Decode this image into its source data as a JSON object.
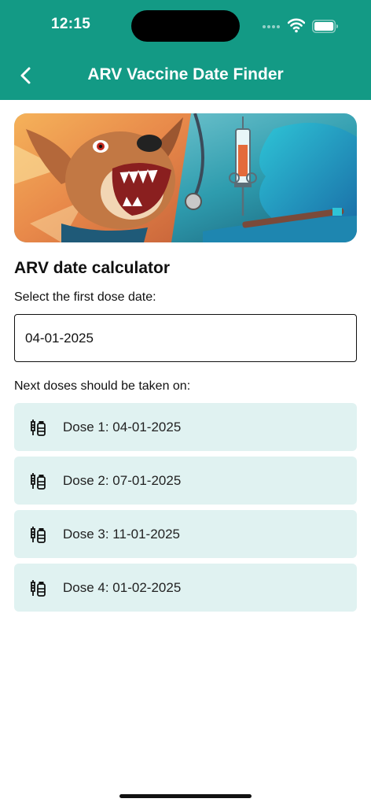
{
  "status_bar": {
    "time": "12:15"
  },
  "app_bar": {
    "title": "ARV Vaccine Date Finder",
    "back_icon": "chevron-left-icon"
  },
  "banner": {
    "description": "dog-and-syringe-illustration"
  },
  "calculator": {
    "heading": "ARV date calculator",
    "select_label": "Select the first dose date:",
    "first_dose_value": "04-01-2025",
    "next_label": "Next doses should be taken on:"
  },
  "doses": [
    {
      "text": "Dose 1: 04-01-2025"
    },
    {
      "text": "Dose 2: 07-01-2025"
    },
    {
      "text": "Dose 3: 11-01-2025"
    },
    {
      "text": "Dose 4: 01-02-2025"
    }
  ],
  "colors": {
    "header": "#139a85",
    "dose_background": "#e0f2f1"
  }
}
